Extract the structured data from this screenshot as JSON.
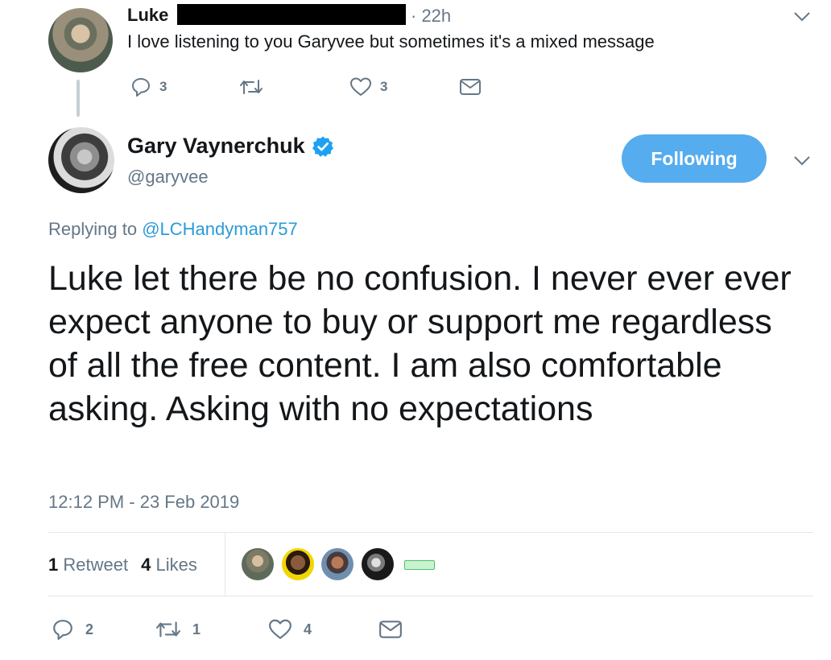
{
  "parent_tweet": {
    "author_name": "Luke",
    "time": "· 22h",
    "text": "I love listening to you Garyvee but sometimes it's a mixed message",
    "actions": {
      "reply_count": "3",
      "retweet_count": "",
      "like_count": "3"
    }
  },
  "main_tweet": {
    "author_name": "Gary Vaynerchuk",
    "handle": "@garyvee",
    "follow_button_label": "Following",
    "replying_prefix": "Replying to",
    "replying_to": "@LCHandyman757",
    "text": "Luke let there be no confusion. I never ever ever expect anyone to buy or support me regardless of all the free content. I am also comfortable asking. Asking with no expectations",
    "timestamp": "12:12 PM - 23 Feb 2019",
    "stats": {
      "retweets_count": "1",
      "retweets_label": "Retweet",
      "likes_count": "4",
      "likes_label": "Likes"
    },
    "actions": {
      "reply_count": "2",
      "retweet_count": "1",
      "like_count": "4"
    }
  },
  "colors": {
    "accent": "#55acee",
    "link": "#2b9bd8",
    "muted": "#657786",
    "icon": "#657786",
    "verified": "#1da1f2"
  },
  "icons": [
    "reply-icon",
    "retweet-icon",
    "like-icon",
    "dm-icon",
    "chevron-down-icon",
    "verified-badge-icon"
  ]
}
